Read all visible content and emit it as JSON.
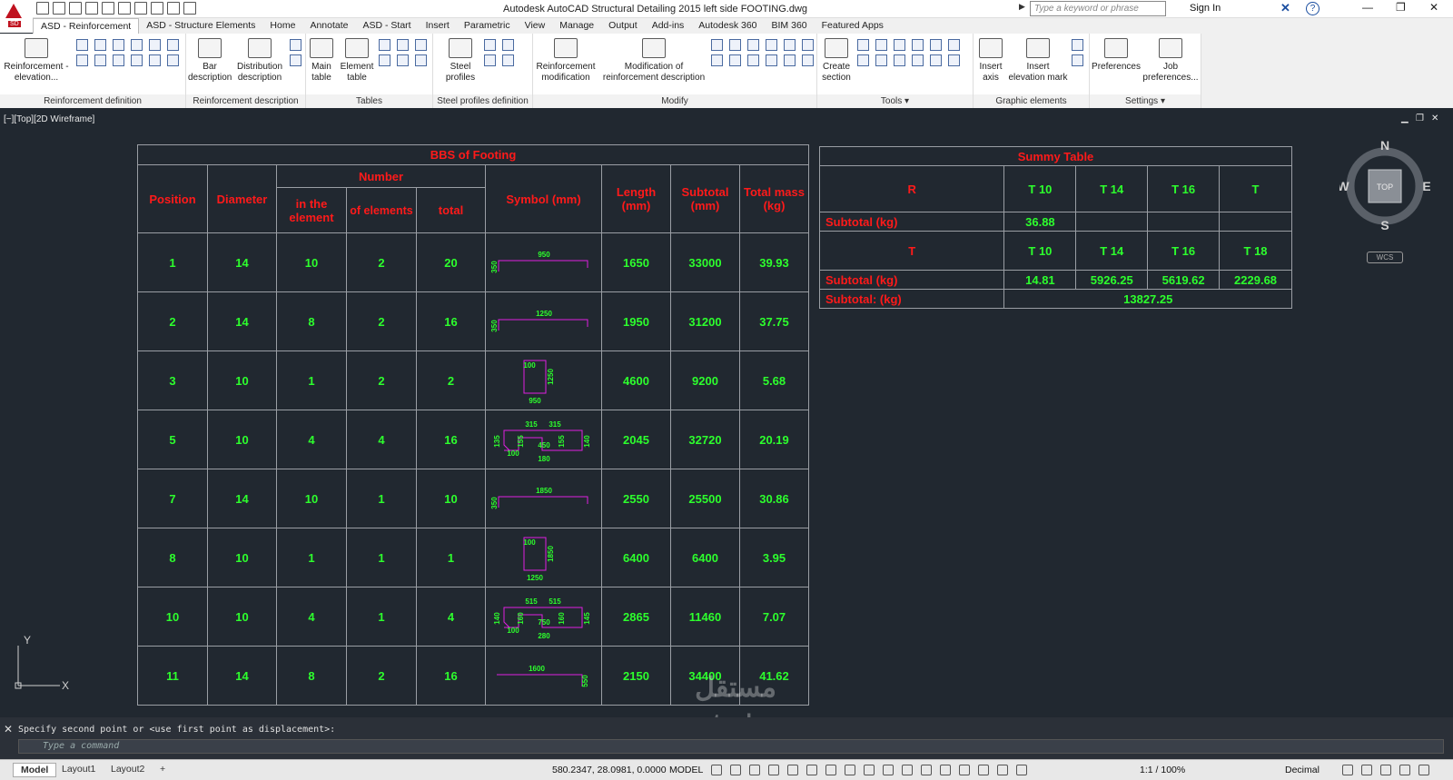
{
  "titlebar": {
    "title": "Autodesk AutoCAD Structural Detailing 2015    left side FOOTING.dwg",
    "search_placeholder": "Type a keyword or phrase",
    "signin": "Sign In",
    "app_sub": "SD"
  },
  "tabs": [
    "ASD - Reinforcement",
    "ASD - Structure Elements",
    "Home",
    "Annotate",
    "ASD - Start",
    "Insert",
    "Parametric",
    "View",
    "Manage",
    "Output",
    "Add-ins",
    "Autodesk 360",
    "BIM 360",
    "Featured Apps"
  ],
  "ribbon": {
    "panels": {
      "reinf_def": "Reinforcement definition",
      "reinf_desc": "Reinforcement description",
      "tables": "Tables",
      "steel": "Steel profiles definition",
      "modify": "Modify",
      "tools": "Tools ▾",
      "graphic": "Graphic elements",
      "settings": "Settings ▾"
    },
    "tools": {
      "reinf_elev": "Reinforcement - elevation...",
      "bar_desc": "Bar description",
      "dist_desc": "Distribution description",
      "main_table": "Main table",
      "element_table": "Element table",
      "steel_profiles": "Steel profiles",
      "reinf_mod": "Reinforcement modification",
      "mod_reinf_desc": "Modification of reinforcement description",
      "create_section": "Create section",
      "insert_axis": "Insert axis",
      "insert_elev": "Insert elevation mark",
      "preferences": "Preferences",
      "job_prefs": "Job preferences..."
    }
  },
  "viewport": {
    "label": "[−][Top][2D Wireframe]"
  },
  "bbs": {
    "title": "BBS of Footing",
    "h_position": "Position",
    "h_diameter": "Diameter",
    "h_number": "Number",
    "h_in_element": "in the element",
    "h_of_elements": "of elements",
    "h_total": "total",
    "h_symbol": "Symbol (mm)",
    "h_length": "Length (mm)",
    "h_subtotal": "Subtotal (mm)",
    "h_mass": "Total mass (kg)",
    "rows": [
      {
        "pos": "1",
        "dia": "14",
        "in_el": "10",
        "of_el": "2",
        "total": "20",
        "len": "1650",
        "sub": "33000",
        "mass": "39.93",
        "sym": {
          "type": "hook",
          "a": "950",
          "b": "350"
        }
      },
      {
        "pos": "2",
        "dia": "14",
        "in_el": "8",
        "of_el": "2",
        "total": "16",
        "len": "1950",
        "sub": "31200",
        "mass": "37.75",
        "sym": {
          "type": "hook",
          "a": "1250",
          "b": "350"
        }
      },
      {
        "pos": "3",
        "dia": "10",
        "in_el": "1",
        "of_el": "2",
        "total": "2",
        "len": "4600",
        "sub": "9200",
        "mass": "5.68",
        "sym": {
          "type": "rect",
          "a": "100",
          "b": "1250",
          "c": "950"
        }
      },
      {
        "pos": "5",
        "dia": "10",
        "in_el": "4",
        "of_el": "4",
        "total": "16",
        "len": "2045",
        "sub": "32720",
        "mass": "20.19",
        "sym": {
          "type": "complex",
          "t1": "315",
          "t2": "315",
          "m": "450",
          "l1": "135",
          "l2": "155",
          "l3": "100",
          "r1": "155",
          "r2": "140",
          "bt": "180"
        }
      },
      {
        "pos": "7",
        "dia": "14",
        "in_el": "10",
        "of_el": "1",
        "total": "10",
        "len": "2550",
        "sub": "25500",
        "mass": "30.86",
        "sym": {
          "type": "hook",
          "a": "1850",
          "b": "350"
        }
      },
      {
        "pos": "8",
        "dia": "10",
        "in_el": "1",
        "of_el": "1",
        "total": "1",
        "len": "6400",
        "sub": "6400",
        "mass": "3.95",
        "sym": {
          "type": "rect",
          "a": "100",
          "b": "1850",
          "c": "1250"
        }
      },
      {
        "pos": "10",
        "dia": "10",
        "in_el": "4",
        "of_el": "1",
        "total": "4",
        "len": "2865",
        "sub": "11460",
        "mass": "7.07",
        "sym": {
          "type": "complex",
          "t1": "515",
          "t2": "515",
          "m": "750",
          "l1": "140",
          "l2": "160",
          "l3": "100",
          "r1": "160",
          "r2": "145",
          "bt": "280"
        }
      },
      {
        "pos": "11",
        "dia": "14",
        "in_el": "8",
        "of_el": "2",
        "total": "16",
        "len": "2150",
        "sub": "34400",
        "mass": "41.62",
        "sym": {
          "type": "hookdown",
          "a": "1600",
          "b": "550"
        }
      }
    ]
  },
  "summy": {
    "title": "Summy Table",
    "r_label": "R",
    "r_cols": [
      "T 10",
      "T 14",
      "T 16",
      "T"
    ],
    "r_sub_label": "Subtotal (kg)",
    "r_sub": [
      "36.88",
      "",
      "",
      ""
    ],
    "t_label": "T",
    "t_cols": [
      "T 10",
      "T 14",
      "T 16",
      "T 18"
    ],
    "t_sub_label": "Subtotal (kg)",
    "t_sub": [
      "14.81",
      "5926.25",
      "5619.62",
      "2229.68"
    ],
    "total_label": "Subtotal: (kg)",
    "total": "13827.25"
  },
  "compass": {
    "n": "N",
    "s": "S",
    "e": "E",
    "w": "W",
    "top": "TOP",
    "wcs": "WCS"
  },
  "ucs": {
    "x": "X",
    "y": "Y"
  },
  "watermark": {
    "line1": "مستقل",
    "line2": "mostaql.com"
  },
  "command": {
    "history": "Specify second point or <use first point as displacement>:",
    "placeholder": "Type a command"
  },
  "status": {
    "layouts": [
      "Model",
      "Layout1",
      "Layout2"
    ],
    "coords": "580.2347, 28.0981, 0.0000",
    "model": "MODEL",
    "scale": "1:1 / 100%",
    "units": "Decimal"
  },
  "colors": {
    "bg": "#212830",
    "red": "#ff1a1a",
    "green": "#2dff2d",
    "magenta": "#e020e0"
  }
}
